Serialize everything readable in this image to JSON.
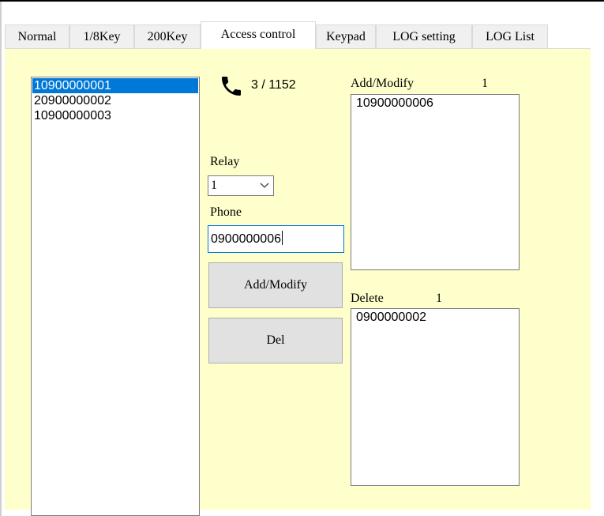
{
  "tabs": [
    {
      "label": "Normal",
      "active": false
    },
    {
      "label": "1/8Key",
      "active": false
    },
    {
      "label": "200Key",
      "active": false
    },
    {
      "label": "Access control",
      "active": true
    },
    {
      "label": "Keypad",
      "active": false
    },
    {
      "label": "LOG setting",
      "active": false
    },
    {
      "label": "LOG List",
      "active": false
    }
  ],
  "access_control": {
    "phone_list": [
      "10900000001",
      "20900000002",
      "10900000003"
    ],
    "phone_list_selected": "10900000001",
    "phone_icon": "phone-handset-icon",
    "count_text": "3 / 1152",
    "relay_label": "Relay",
    "relay_value": "1",
    "phone_label": "Phone",
    "phone_value": "0900000006",
    "add_modify_button": "Add/Modify",
    "del_button": "Del",
    "add_modify_label": "Add/Modify",
    "add_modify_count": "1",
    "add_modify_list": [
      "10900000006"
    ],
    "delete_label": "Delete",
    "delete_count": "1",
    "delete_list": [
      "0900000002"
    ]
  },
  "colors": {
    "panel_bg": "#ffffcc",
    "selection": "#0078d7",
    "focus_border": "#0078d7"
  }
}
